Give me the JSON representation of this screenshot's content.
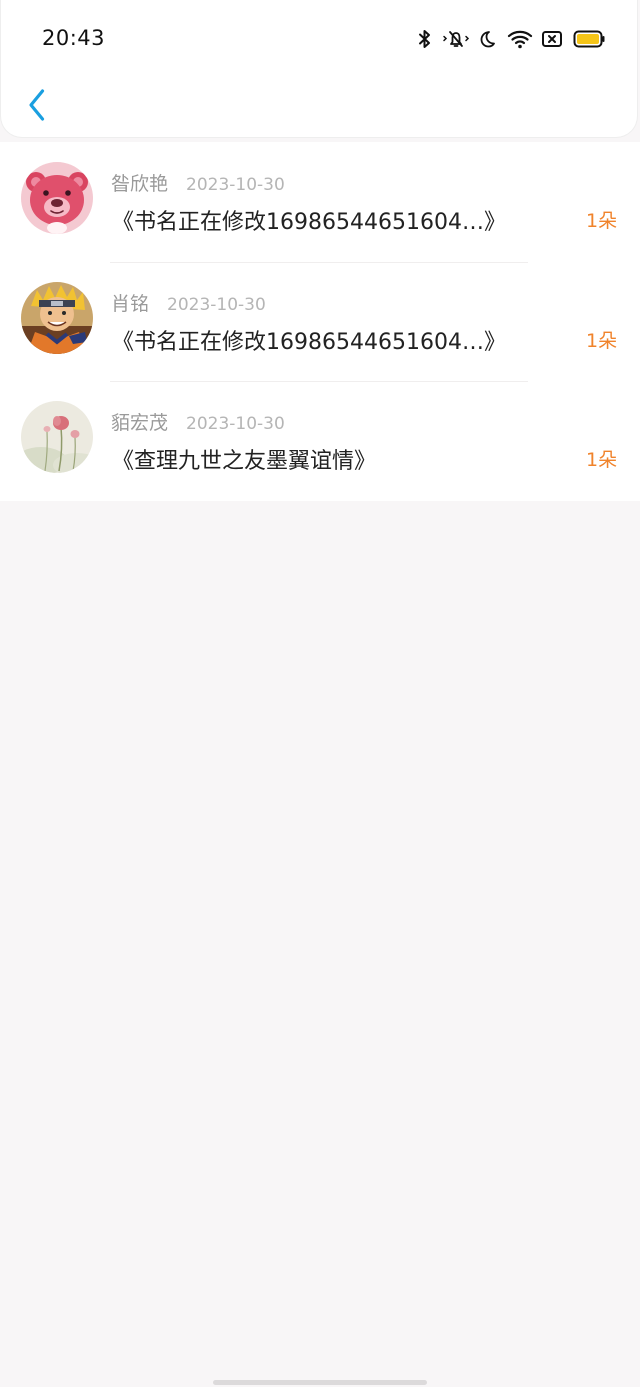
{
  "status_bar": {
    "time": "20:43",
    "icons": [
      "bluetooth-icon",
      "mute-icon",
      "moon-icon",
      "wifi-icon",
      "sim-card-icon",
      "battery-icon"
    ],
    "battery_color": "#f5c518"
  },
  "header": {
    "back_icon": "chevron-left-icon",
    "accent_color": "#1a9fe0"
  },
  "records": [
    {
      "name": "昝欣艳",
      "date": "2023-10-30",
      "title": "《书名正在修改16986544651604…》",
      "count": "1朵",
      "avatar": "pink-bear-avatar"
    },
    {
      "name": "肖铭",
      "date": "2023-10-30",
      "title": "《书名正在修改16986544651604…》",
      "count": "1朵",
      "avatar": "anime-character-avatar"
    },
    {
      "name": "貊宏茂",
      "date": "2023-10-30",
      "title": "《查理九世之友墨翼谊情》",
      "count": "1朵",
      "avatar": "flower-avatar"
    }
  ],
  "colors": {
    "count": "#f0832b",
    "background": "#f8f6f7"
  }
}
